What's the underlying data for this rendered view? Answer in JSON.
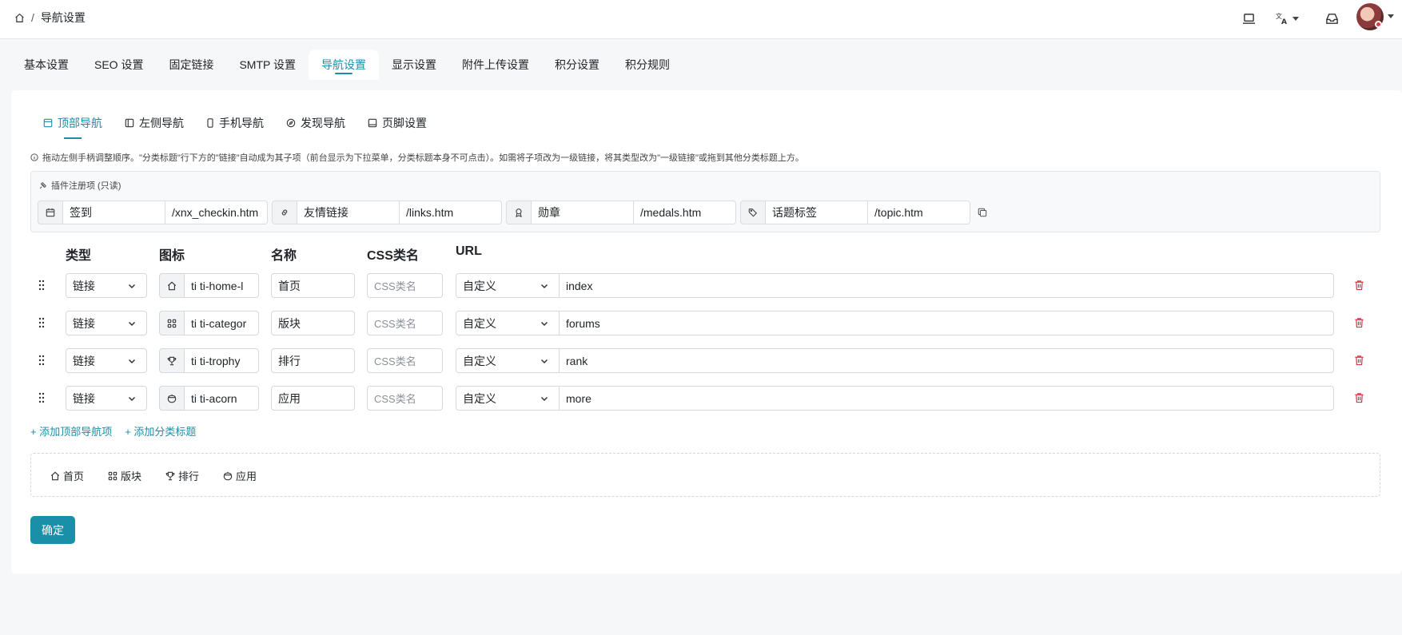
{
  "breadcrumb": {
    "home_icon": "home-icon",
    "separator": "/",
    "current": "导航设置"
  },
  "topbar_icons": [
    "laptop-icon",
    "translate-icon",
    "inbox-icon"
  ],
  "tabs": [
    "基本设置",
    "SEO 设置",
    "固定链接",
    "SMTP 设置",
    "导航设置",
    "显示设置",
    "附件上传设置",
    "积分设置",
    "积分规则"
  ],
  "active_tab": "导航设置",
  "subtabs": [
    {
      "label": "顶部导航",
      "icon": "layout-navbar-icon"
    },
    {
      "label": "左侧导航",
      "icon": "layout-sidebar-icon"
    },
    {
      "label": "手机导航",
      "icon": "device-mobile-icon"
    },
    {
      "label": "发现导航",
      "icon": "compass-icon"
    },
    {
      "label": "页脚设置",
      "icon": "layout-bottombar-icon"
    }
  ],
  "hint": "拖动左侧手柄调整顺序。\"分类标题\"行下方的\"链接\"自动成为其子项（前台显示为下拉菜单，分类标题本身不可点击）。如需将子项改为一级链接，将其类型改为\"一级链接\"或拖到其他分类标题上方。",
  "plugins": {
    "title": "插件注册项 (只读)",
    "items": [
      {
        "icon": "calendar-icon",
        "name": "签到",
        "url": "/xnx_checkin.htm"
      },
      {
        "icon": "link-icon",
        "name": "友情链接",
        "url": "/links.htm"
      },
      {
        "icon": "award-icon",
        "name": "勋章",
        "url": "/medals.htm"
      },
      {
        "icon": "tags-icon",
        "name": "话题标签",
        "url": "/topic.htm"
      }
    ]
  },
  "columns": {
    "type": "类型",
    "icon": "图标",
    "name": "名称",
    "css": "CSS类名",
    "url": "URL"
  },
  "rows": [
    {
      "type": "链接",
      "icon_name": "home-icon",
      "icon": "ti ti-home-l",
      "name": "首页",
      "css_placeholder": "CSS类名",
      "url_type": "自定义",
      "url": "index"
    },
    {
      "type": "链接",
      "icon_name": "category-icon",
      "icon": "ti ti-categor",
      "name": "版块",
      "css_placeholder": "CSS类名",
      "url_type": "自定义",
      "url": "forums"
    },
    {
      "type": "链接",
      "icon_name": "trophy-icon",
      "icon": "ti ti-trophy",
      "name": "排行",
      "css_placeholder": "CSS类名",
      "url_type": "自定义",
      "url": "rank"
    },
    {
      "type": "链接",
      "icon_name": "acorn-icon",
      "icon": "ti ti-acorn",
      "name": "应用",
      "css_placeholder": "CSS类名",
      "url_type": "自定义",
      "url": "more"
    }
  ],
  "add_links": [
    "+ 添加顶部导航项",
    "+ 添加分类标题"
  ],
  "preview": [
    {
      "icon": "home-icon",
      "label": "首页"
    },
    {
      "icon": "category-icon",
      "label": "版块"
    },
    {
      "icon": "trophy-icon",
      "label": "排行"
    },
    {
      "icon": "acorn-icon",
      "label": "应用"
    }
  ],
  "submit_label": "确定",
  "colors": {
    "accent": "#1a8fa8",
    "danger": "#dc3545"
  }
}
